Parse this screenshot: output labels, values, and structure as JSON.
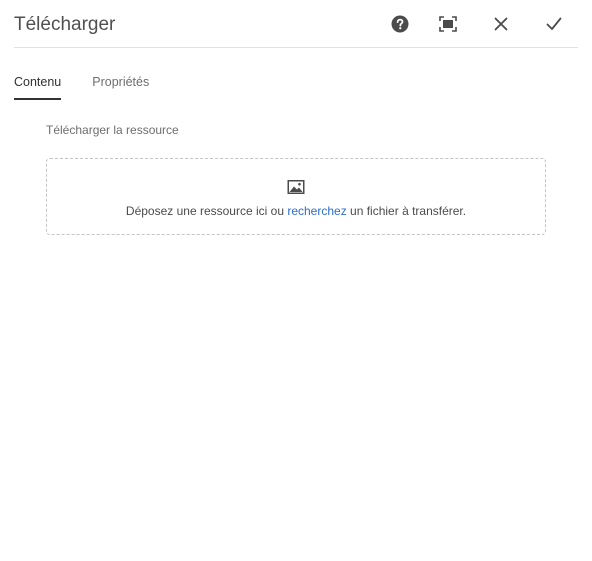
{
  "dialog": {
    "title": "Télécharger"
  },
  "header": {
    "help_icon": "help-icon",
    "fullscreen_icon": "fullscreen-icon",
    "close_icon": "close-icon",
    "done_icon": "checkmark-icon"
  },
  "tabs": [
    {
      "label": "Contenu",
      "active": true
    },
    {
      "label": "Propriétés",
      "active": false
    }
  ],
  "content": {
    "field_label": "Télécharger la ressource",
    "dropzone": {
      "icon": "image-icon",
      "text_before": "Déposez une ressource ici ou ",
      "link_text": "recherchez",
      "text_after": " un fichier à transférer."
    }
  },
  "colors": {
    "link": "#2c6ecb",
    "active_tab_underline": "#323232",
    "header_border": "#e1e1e1",
    "dropzone_border": "#c4c4c4"
  }
}
